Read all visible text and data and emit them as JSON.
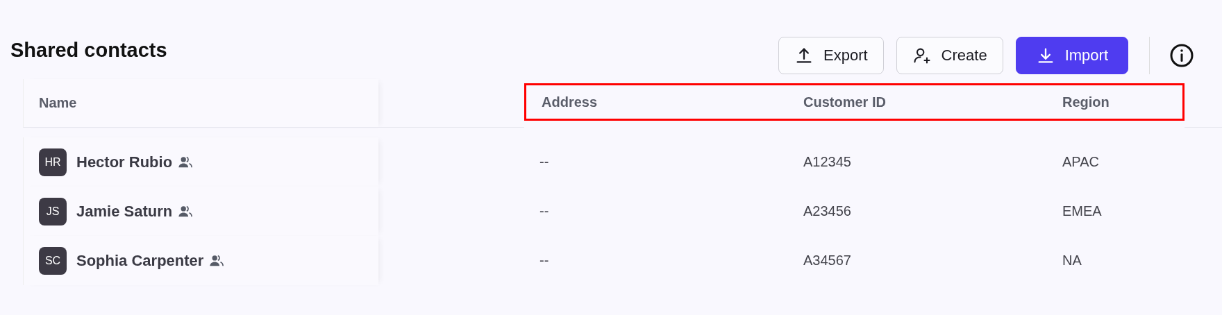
{
  "title": "Shared contacts",
  "buttons": [
    {
      "label": "Export",
      "kind": "export",
      "primary": false
    },
    {
      "label": "Create",
      "kind": "create",
      "primary": false
    },
    {
      "label": "Import",
      "kind": "import",
      "primary": true
    }
  ],
  "table": {
    "columns": [
      {
        "label": "Name",
        "highlighted": false
      },
      {
        "label": "Address",
        "highlighted": true
      },
      {
        "label": "Customer ID",
        "highlighted": true
      },
      {
        "label": "Region",
        "highlighted": true
      }
    ],
    "rows": [
      {
        "initials": "HR",
        "name": "Hector Rubio",
        "shared": true,
        "address": "--",
        "customer_id": "A12345",
        "region": "APAC"
      },
      {
        "initials": "JS",
        "name": "Jamie Saturn",
        "shared": true,
        "address": "--",
        "customer_id": "A23456",
        "region": "EMEA"
      },
      {
        "initials": "SC",
        "name": "Sophia Carpenter",
        "shared": true,
        "address": "--",
        "customer_id": "A34567",
        "region": "NA"
      }
    ]
  }
}
